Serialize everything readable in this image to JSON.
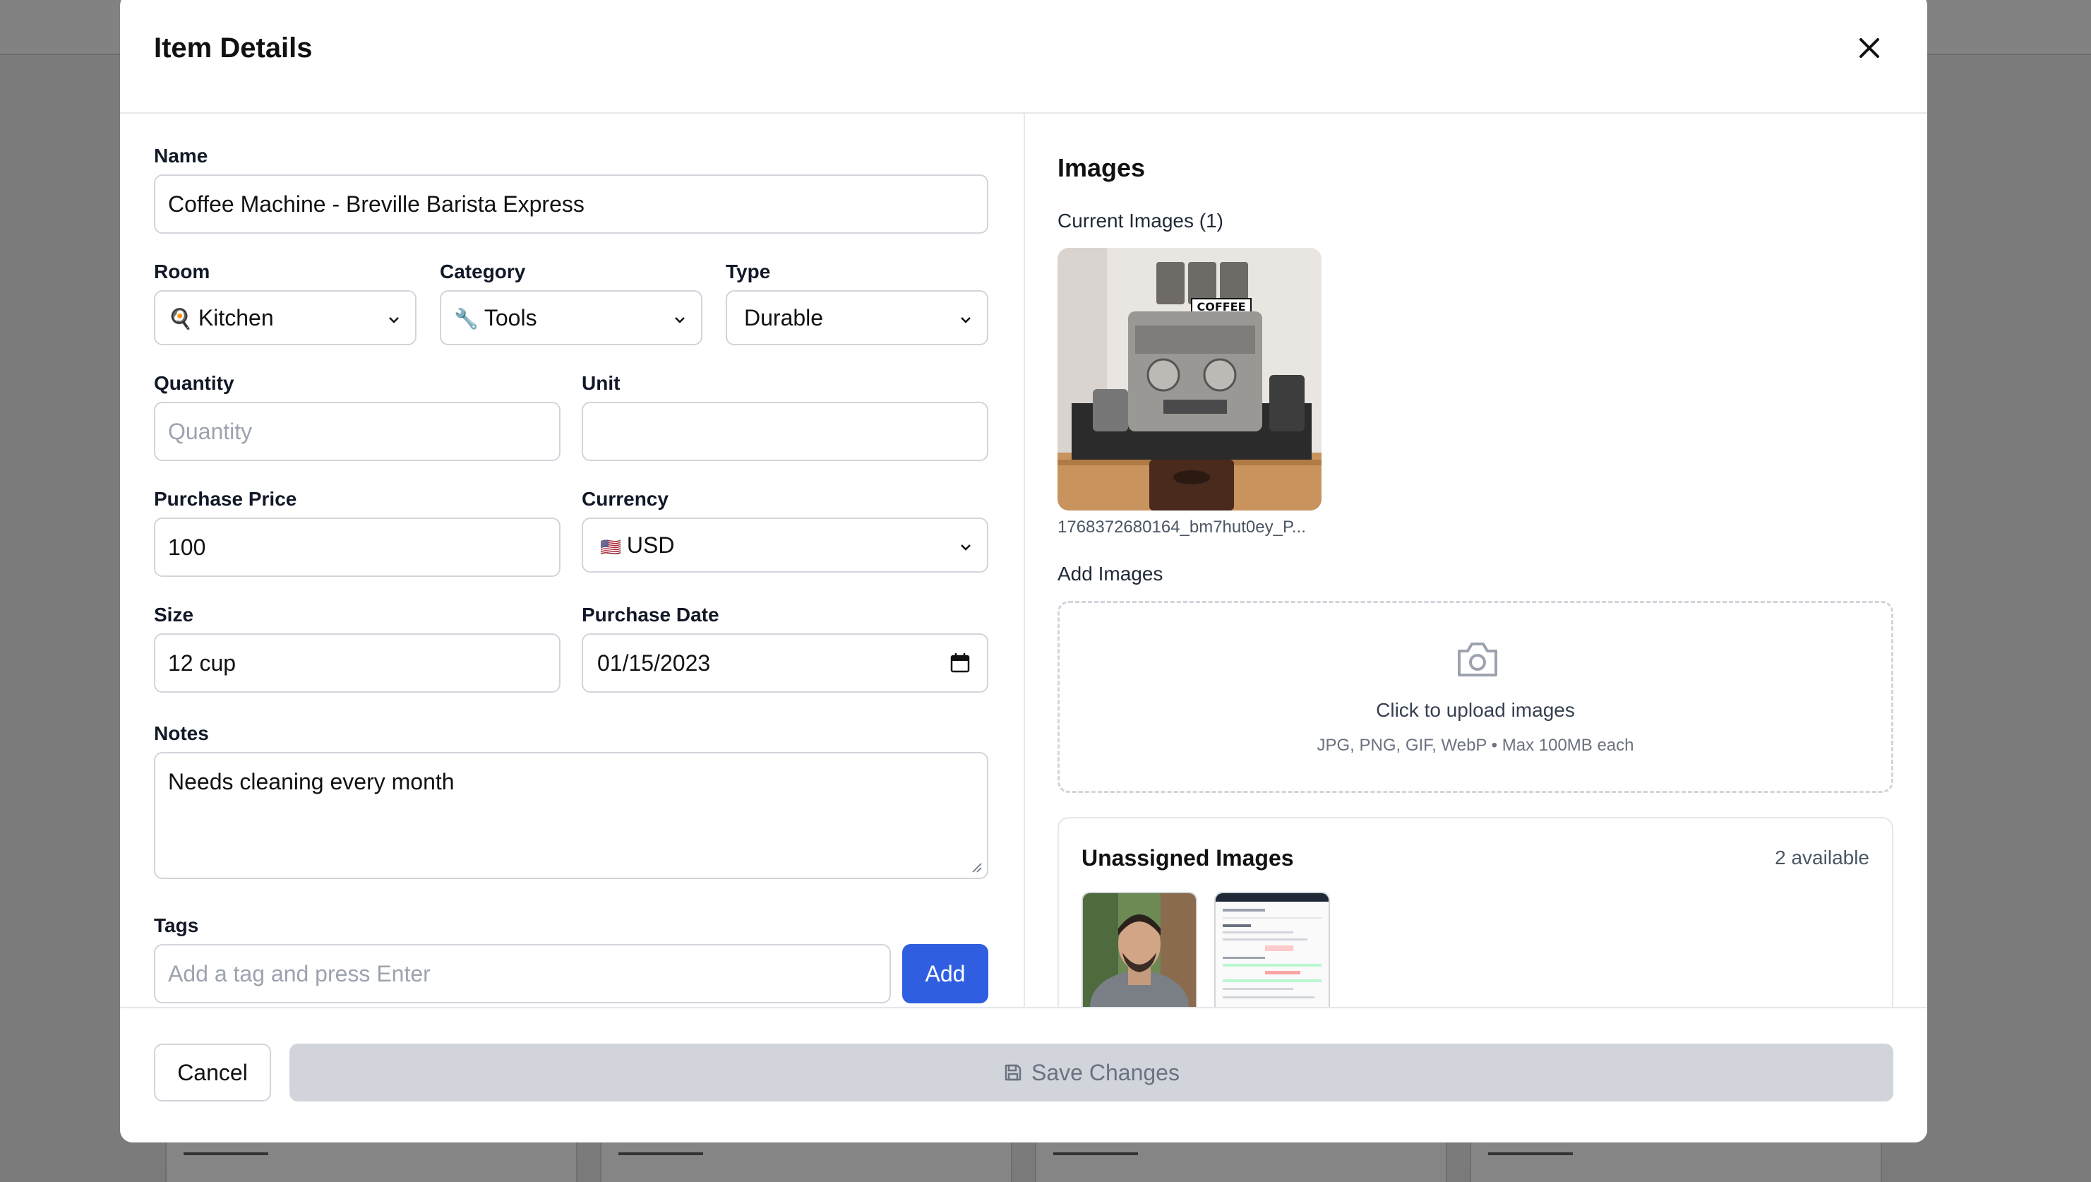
{
  "modal": {
    "title": "Item Details",
    "close_icon": "close-icon"
  },
  "form": {
    "name": {
      "label": "Name",
      "value": "Coffee Machine - Breville Barista Express"
    },
    "room": {
      "label": "Room",
      "value": "Kitchen",
      "emoji": "🍳"
    },
    "category": {
      "label": "Category",
      "value": "Tools",
      "emoji": "🔧"
    },
    "type": {
      "label": "Type",
      "value": "Durable"
    },
    "quantity": {
      "label": "Quantity",
      "value": "",
      "placeholder": "Quantity"
    },
    "unit": {
      "label": "Unit",
      "value": ""
    },
    "purchase_price": {
      "label": "Purchase Price",
      "value": "100"
    },
    "currency": {
      "label": "Currency",
      "value": "USD",
      "emoji": "🇺🇸"
    },
    "size": {
      "label": "Size",
      "value": "12 cup"
    },
    "purchase_date": {
      "label": "Purchase Date",
      "value": "01/15/2023"
    },
    "notes": {
      "label": "Notes",
      "value": "Needs cleaning every month"
    },
    "tags": {
      "label": "Tags",
      "placeholder": "Add a tag and press Enter",
      "add_label": "Add"
    }
  },
  "images": {
    "title": "Images",
    "current_label": "Current Images (1)",
    "current": [
      {
        "filename": "1768372680164_bm7hut0ey_P..."
      }
    ],
    "add_label": "Add Images",
    "upload": {
      "main": "Click to upload images",
      "hint": "JPG, PNG, GIF, WebP • Max 100MB each"
    },
    "unassigned": {
      "title": "Unassigned Images",
      "count": "2 available"
    }
  },
  "footer": {
    "cancel_label": "Cancel",
    "save_label": "Save Changes"
  },
  "colors": {
    "accent": "#2f5fe0",
    "border": "#d1d5db",
    "disabled_button": "#d1d5db",
    "overlay": "#7b7b7b"
  }
}
